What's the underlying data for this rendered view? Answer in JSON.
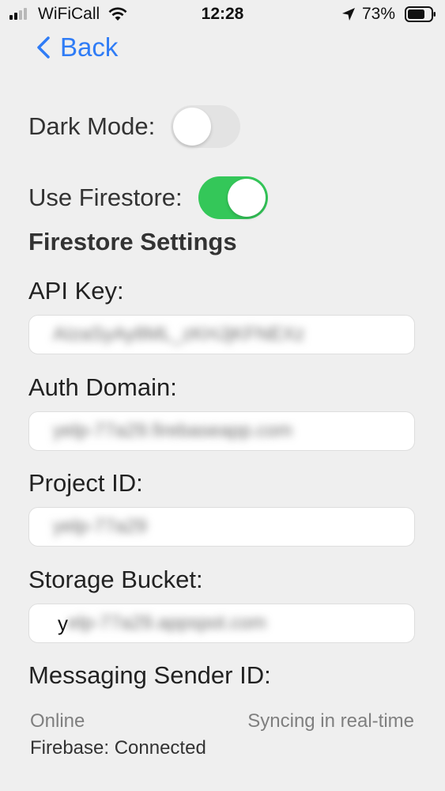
{
  "status_bar": {
    "carrier": "WiFiCall",
    "time": "12:28",
    "battery": "73%"
  },
  "nav": {
    "back_label": "Back"
  },
  "settings": {
    "dark_mode": {
      "label": "Dark Mode:",
      "enabled": false
    },
    "use_firestore": {
      "label": "Use Firestore:",
      "enabled": true
    }
  },
  "firestore_settings": {
    "title": "Firestore Settings",
    "fields": [
      {
        "label": "API Key:",
        "value": "AIzaSyAy8ML_zKHJjKFNEXz",
        "redacted": true
      },
      {
        "label": "Auth Domain:",
        "value": "yelp-77a29.firebaseapp.com",
        "redacted": true
      },
      {
        "label": "Project ID:",
        "value": "yelp-77a29",
        "redacted": true
      },
      {
        "label": "Storage Bucket:",
        "value_visible": "y",
        "value_redacted": "elp-77a29.appspot.com",
        "redacted": true
      },
      {
        "label": "Messaging Sender ID:"
      }
    ]
  },
  "footer": {
    "connection": "Online",
    "sync": "Syncing in real-time",
    "firebase_status": "Firebase: Connected"
  },
  "colors": {
    "accent": "#2f7cf6",
    "toggle_on": "#34c759",
    "toggle_off": "#e3e3e3",
    "background": "#efefef"
  },
  "icons": {
    "signal": "signal-bars-icon",
    "wifi": "wifi-icon",
    "location": "location-arrow-icon",
    "battery": "battery-icon",
    "back": "chevron-left-icon"
  }
}
